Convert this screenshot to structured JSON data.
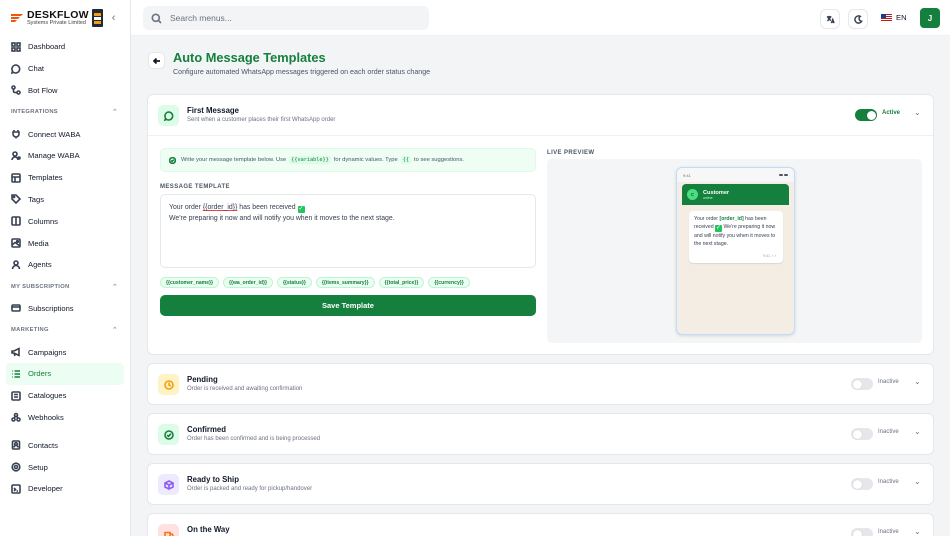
{
  "brand": {
    "name": "DESKFLOW",
    "sub": "Systems Private Limited"
  },
  "sidebar": {
    "items_top": [
      {
        "label": "Dashboard",
        "icon": "grid-icon"
      },
      {
        "label": "Chat",
        "icon": "chat-icon"
      },
      {
        "label": "Bot Flow",
        "icon": "flow-icon"
      }
    ],
    "sections": [
      {
        "title": "INTEGRATIONS",
        "items": [
          {
            "label": "Connect WABA",
            "icon": "plug-icon"
          },
          {
            "label": "Manage WABA",
            "icon": "user-gear-icon"
          },
          {
            "label": "Templates",
            "icon": "template-icon"
          },
          {
            "label": "Tags",
            "icon": "tag-icon"
          },
          {
            "label": "Columns",
            "icon": "columns-icon"
          },
          {
            "label": "Media",
            "icon": "image-icon"
          },
          {
            "label": "Agents",
            "icon": "agents-icon"
          }
        ]
      },
      {
        "title": "MY SUBSCRIPTION",
        "items": [
          {
            "label": "Subscriptions",
            "icon": "card-icon"
          }
        ]
      },
      {
        "title": "MARKETING",
        "items": [
          {
            "label": "Campaigns",
            "icon": "megaphone-icon"
          },
          {
            "label": "Orders",
            "icon": "list-icon"
          },
          {
            "label": "Catalogues",
            "icon": "catalogue-icon"
          },
          {
            "label": "Webhooks",
            "icon": "webhook-icon"
          }
        ]
      }
    ],
    "items_bottom": [
      {
        "label": "Contacts",
        "icon": "contacts-icon"
      },
      {
        "label": "Setup",
        "icon": "settings-icon"
      },
      {
        "label": "Developer",
        "icon": "developer-icon"
      }
    ],
    "active": "Orders"
  },
  "topbar": {
    "search_placeholder": "Search menus...",
    "language": "EN",
    "avatar_initial": "J"
  },
  "header": {
    "title": "Auto Message Templates",
    "subtitle": "Configure automated WhatsApp messages triggered on each order status change"
  },
  "first_message": {
    "title": "First Message",
    "description": "Sent when a customer places their first WhatsApp order",
    "status": "Active",
    "info_before": "Write your message template below. Use",
    "info_variable": "{{variable}}",
    "info_middle": "for dynamic values. Type",
    "info_brace": "{{",
    "info_after": "to see suggestions.",
    "template_label": "MESSAGE TEMPLATE",
    "template_line1_a": "Your order ",
    "template_line1_tag": "{{order_id}}",
    "template_line1_b": " has been received ",
    "template_line2": "We're preparing it now and will notify you when it moves to the next stage.",
    "chips": [
      "{{customer_name}}",
      "{{wa_order_id}}",
      "{{status}}",
      "{{items_summary}}",
      "{{total_price}}",
      "{{currency}}"
    ],
    "save_label": "Save Template",
    "preview_label": "LIVE PREVIEW",
    "phone_time": "9:41",
    "chat_avatar": "C",
    "chat_name": "Customer",
    "chat_status": "online",
    "bubble_a": "Your order ",
    "bubble_tag": "[order_id]",
    "bubble_b": " has been received ",
    "bubble_c": " We're preparing it now and will notify you when it moves to the next stage.",
    "bubble_time": "9:41 ✓✓"
  },
  "status_cards": [
    {
      "title": "Pending",
      "description": "Order is received and awaiting confirmation",
      "status": "Inactive",
      "icon": "clock-icon"
    },
    {
      "title": "Confirmed",
      "description": "Order has been confirmed and is being processed",
      "status": "Inactive",
      "icon": "check-circle-icon"
    },
    {
      "title": "Ready to Ship",
      "description": "Order is packed and ready for pickup/handover",
      "status": "Inactive",
      "icon": "package-icon"
    },
    {
      "title": "On the Way",
      "description": "",
      "status": "Inactive",
      "icon": "truck-icon"
    }
  ],
  "colors": {
    "accent": "#15803d",
    "accent_light": "#dcfce7",
    "background": "#f3f4f6"
  }
}
